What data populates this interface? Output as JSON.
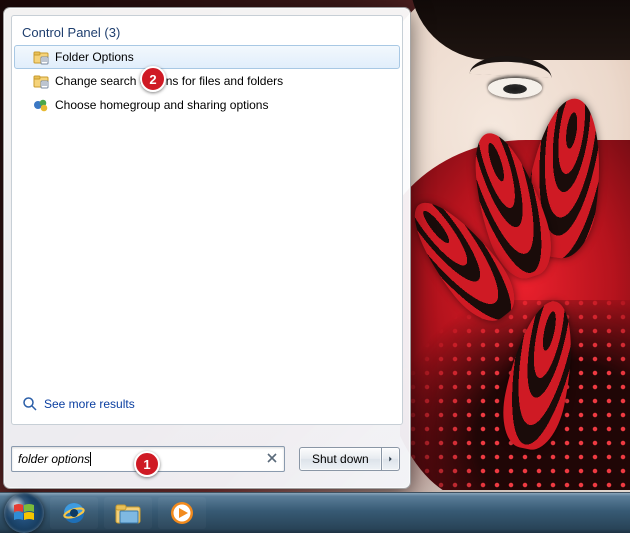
{
  "results": {
    "category_label": "Control Panel (3)",
    "items": [
      {
        "label": "Folder Options",
        "icon": "folder-options-icon",
        "selected": true
      },
      {
        "label": "Change search options for files and folders",
        "icon": "folder-options-icon",
        "selected": false
      },
      {
        "label": "Choose homegroup and sharing options",
        "icon": "homegroup-icon",
        "selected": false
      }
    ],
    "see_more_label": "See more results"
  },
  "search": {
    "value": "folder options",
    "clear_title": "Clear"
  },
  "shutdown": {
    "label": "Shut down"
  },
  "annotations": {
    "badge1": "1",
    "badge2": "2"
  }
}
